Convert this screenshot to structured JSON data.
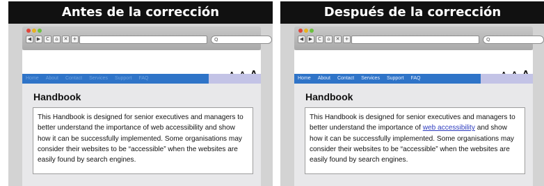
{
  "panels": [
    {
      "heading": "Antes de la corrección",
      "toolbar": {
        "buttons": [
          "◀",
          "▶",
          "C",
          "⌂",
          "✕",
          "+"
        ],
        "search_icon": "Q"
      },
      "text_sizes": [
        "A",
        "A",
        "A"
      ],
      "nav": [
        "Home",
        "About",
        "Contact",
        "Services",
        "Support",
        "FAQ"
      ],
      "page_title": "Handbook",
      "paragraph": {
        "before_link": "This Handbook is designed for senior executives and managers to better understand the importance of ",
        "link": "web accessibility",
        "after_link": " and show how it can be successfully implemented. Some organisations may consider their websites to be “accessible” when the websites are easily found by search engines."
      }
    },
    {
      "heading": "Después de la corrección",
      "toolbar": {
        "buttons": [
          "◀",
          "▶",
          "C",
          "⌂",
          "✕",
          "+"
        ],
        "search_icon": "Q"
      },
      "text_sizes": [
        "A",
        "A",
        "A"
      ],
      "nav": [
        "Home",
        "About",
        "Contact",
        "Services",
        "Support",
        "FAQ"
      ],
      "page_title": "Handbook",
      "paragraph": {
        "before_link": "This Handbook is designed for senior executives and managers to better understand the importance of ",
        "link": "web accessibility",
        "after_link": " and show how it can be successfully implemented. Some organisations may consider their websites to be “accessible” when the websites are easily found by search engines."
      }
    }
  ],
  "colors": {
    "header_bg": "#111111",
    "nav_bg": "#2f74c8",
    "nav_text_before": "#6fa3e0",
    "nav_text_after": "#e6efff",
    "link_after": "#2d3bbf"
  }
}
